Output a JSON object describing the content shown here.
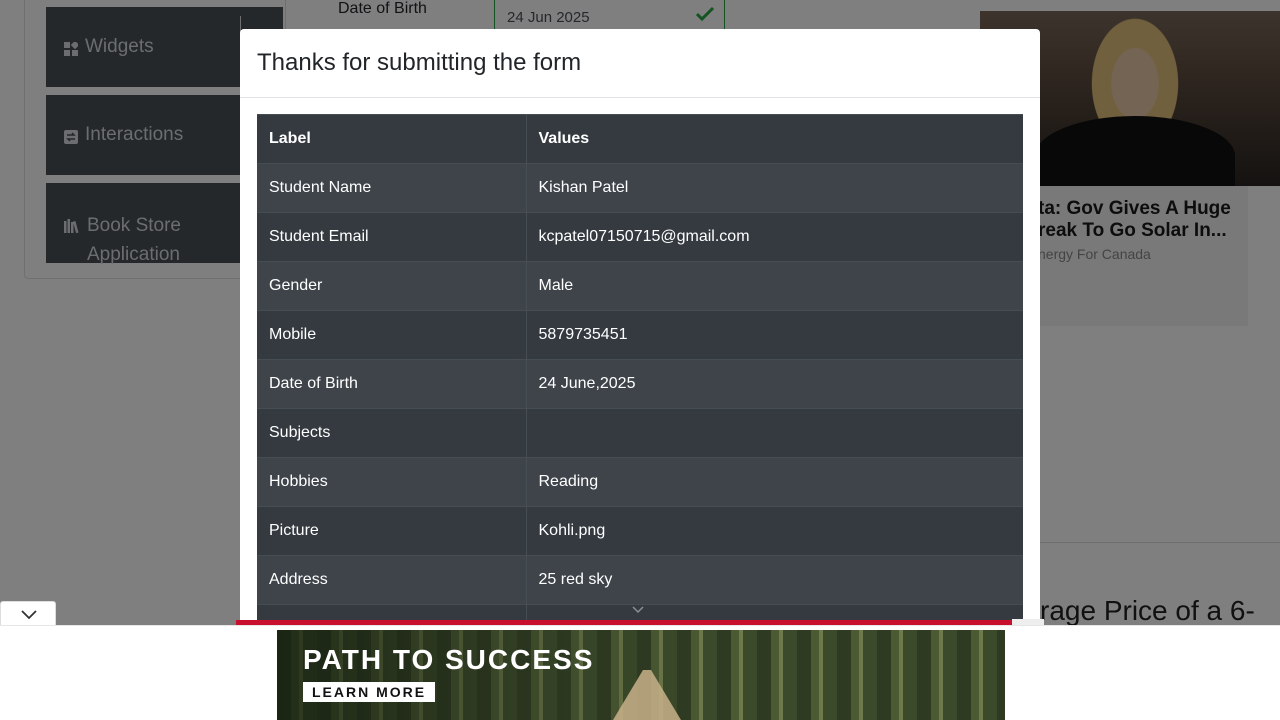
{
  "sidebar": {
    "items": [
      {
        "label": "Widgets",
        "icon": "widgets-icon"
      },
      {
        "label": "Interactions",
        "icon": "interactions-icon"
      },
      {
        "label": "Book Store Application",
        "icon": "book-store-icon"
      }
    ]
  },
  "form": {
    "dob_label": "Date of Birth",
    "dob_value": "24 Jun 2025"
  },
  "right_ad": {
    "headline": "ta: Gov Gives A Huge\nreak To Go Solar In...",
    "sponsor": "nergy For Canada"
  },
  "right_partial_text": "rage Price of a 6-",
  "modal": {
    "title": "Thanks for submitting the form",
    "table": {
      "headers": [
        "Label",
        "Values"
      ],
      "rows": [
        [
          "Student Name",
          "Kishan Patel"
        ],
        [
          "Student Email",
          "kcpatel07150715@gmail.com"
        ],
        [
          "Gender",
          "Male"
        ],
        [
          "Mobile",
          "5879735451"
        ],
        [
          "Date of Birth",
          "24 June,2025"
        ],
        [
          "Subjects",
          ""
        ],
        [
          "Hobbies",
          "Reading"
        ],
        [
          "Picture",
          "Kohli.png"
        ],
        [
          "Address",
          "25 red sky"
        ]
      ]
    }
  },
  "bottom_ad": {
    "title": "PATH TO SUCCESS",
    "cta": "LEARN MORE"
  },
  "colors": {
    "table_bg": "#343a40",
    "table_stripe": "#3e444a",
    "nav_card": "#495057",
    "valid_green": "#28a745",
    "ad_red": "#c8102e"
  }
}
